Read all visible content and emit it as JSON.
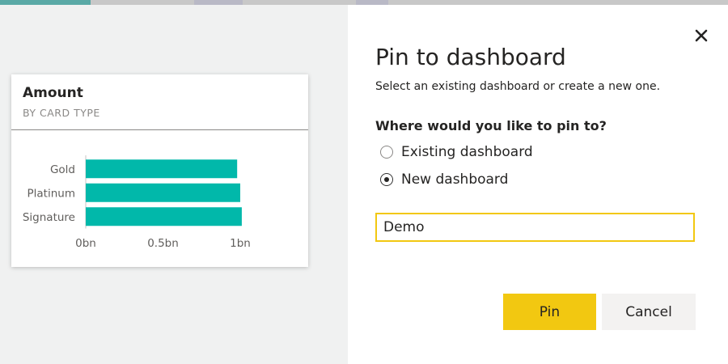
{
  "colors": {
    "accent": "#f2c811",
    "bar": "#01b8aa",
    "cancel_bg": "#f3f2f1",
    "backdrop": "#f0f1f1"
  },
  "card": {
    "title": "Amount",
    "subtitle": "BY CARD TYPE"
  },
  "chart_data": {
    "type": "bar",
    "orientation": "horizontal",
    "categories": [
      "Gold",
      "Platinum",
      "Signature"
    ],
    "values": [
      0.98,
      1.0,
      1.01
    ],
    "value_unit": "bn",
    "x_ticks": [
      "0bn",
      "0.5bn",
      "1bn"
    ],
    "xlim": [
      0,
      1
    ],
    "title": "Amount",
    "subtitle": "BY CARD TYPE",
    "grid": false,
    "color": "#01b8aa"
  },
  "dialog": {
    "close_icon": "close-icon",
    "title": "Pin to dashboard",
    "description": "Select an existing dashboard or create a new one.",
    "question": "Where would you like to pin to?",
    "options": [
      {
        "label": "Existing dashboard",
        "selected": false
      },
      {
        "label": "New dashboard",
        "selected": true
      }
    ],
    "name_input": {
      "value": "Demo"
    },
    "pin_label": "Pin",
    "cancel_label": "Cancel"
  }
}
